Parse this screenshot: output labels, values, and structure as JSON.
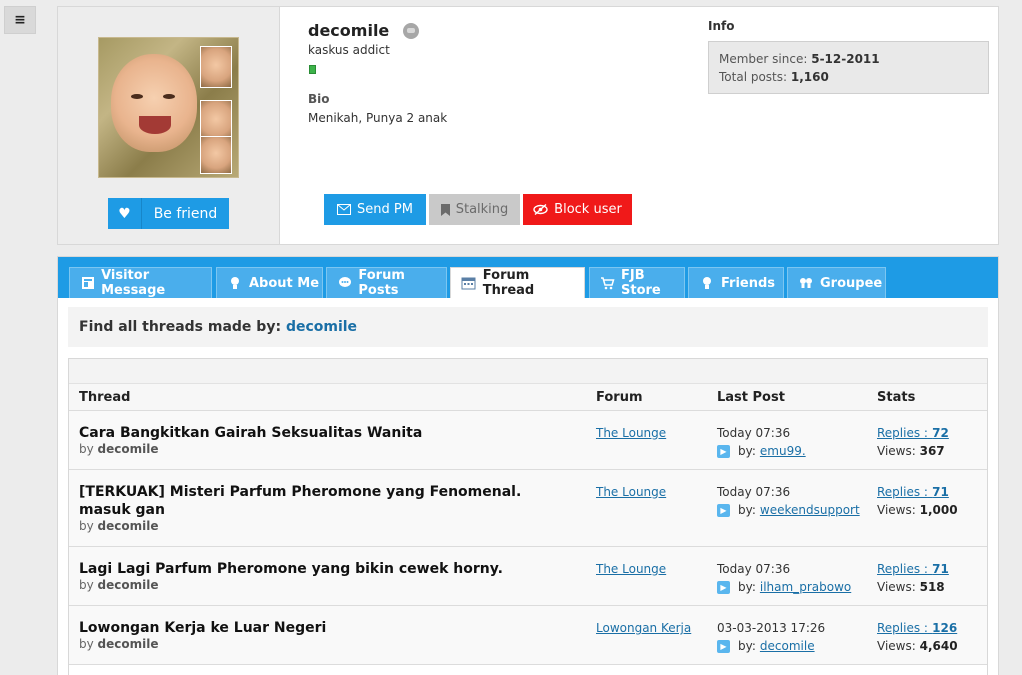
{
  "profile": {
    "username": "decomile",
    "user_title": "kaskus addict",
    "bio_heading": "Bio",
    "bio_text": "Menikah, Punya 2 anak",
    "befriend_label": "Be friend",
    "info_heading": "Info",
    "member_since_label": "Member since:",
    "member_since_value": "5-12-2011",
    "total_posts_label": "Total posts:",
    "total_posts_value": "1,160",
    "actions": {
      "send_pm": "Send PM",
      "stalking": "Stalking",
      "block_user": "Block user"
    },
    "colors": {
      "primary": "#1e9be5",
      "danger": "#f01919",
      "disabled": "#c9c9c9"
    }
  },
  "tabs": [
    {
      "label": "Visitor Message",
      "icon": "message-board-icon"
    },
    {
      "label": "About Me",
      "icon": "person-icon"
    },
    {
      "label": "Forum Posts",
      "icon": "speech-bubble-icon"
    },
    {
      "label": "Forum Thread",
      "icon": "calendar-icon",
      "active": true
    },
    {
      "label": "FJB Store",
      "icon": "cart-icon"
    },
    {
      "label": "Friends",
      "icon": "person-icon"
    },
    {
      "label": "Groupee",
      "icon": "group-icon"
    }
  ],
  "find_bar": {
    "label": "Find all threads made by:",
    "username": "decomile"
  },
  "table": {
    "headers": {
      "thread": "Thread",
      "forum": "Forum",
      "last_post": "Last Post",
      "stats": "Stats"
    },
    "by_prefix": "by",
    "lp_by_prefix": "by:",
    "replies_prefix": "Replies :",
    "views_prefix": "Views:",
    "rows": [
      {
        "title": "Cara Bangkitkan Gairah Seksualitas Wanita",
        "author": "decomile",
        "forum": "The Lounge",
        "last_time": "Today 07:36",
        "last_by": "emu99.",
        "replies": "72",
        "views": "367"
      },
      {
        "title": "[TERKUAK] Misteri Parfum Pheromone yang Fenomenal. masuk gan",
        "author": "decomile",
        "forum": "The Lounge",
        "last_time": "Today 07:36",
        "last_by": "weekendsupport",
        "replies": "71",
        "views": "1,000"
      },
      {
        "title": "Lagi Lagi Parfum Pheromone yang bikin cewek horny.",
        "author": "decomile",
        "forum": "The Lounge",
        "last_time": "Today 07:36",
        "last_by": "ilham_prabowo",
        "replies": "71",
        "views": "518"
      },
      {
        "title": "Lowongan Kerja ke Luar Negeri",
        "author": "decomile",
        "forum": "Lowongan Kerja",
        "last_time": "03-03-2013 17:26",
        "last_by": "decomile",
        "replies": "126",
        "views": "4,640"
      }
    ]
  }
}
